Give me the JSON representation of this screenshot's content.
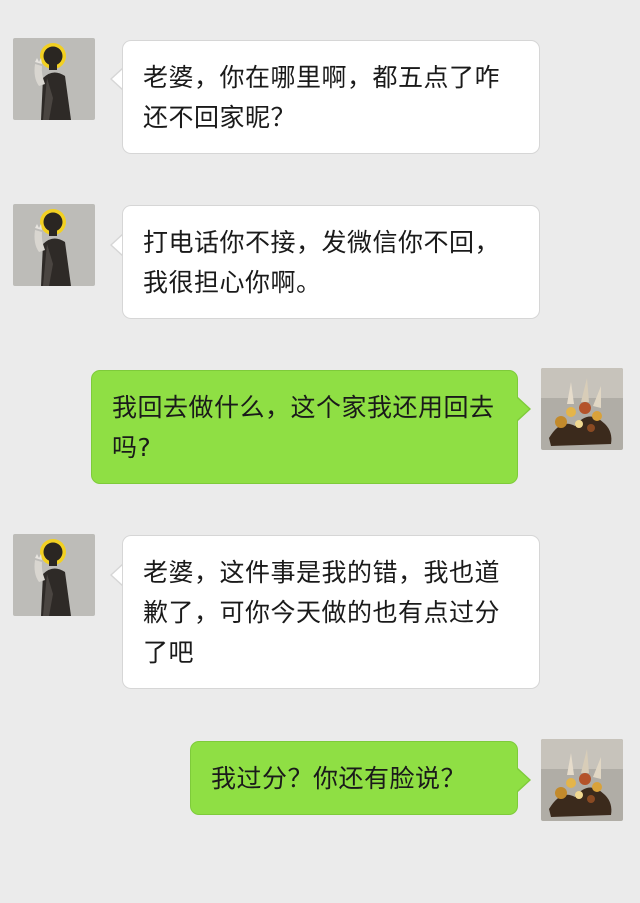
{
  "messages": [
    {
      "sender": "contact",
      "avatar_icon": "jesus-figure-avatar",
      "text": "老婆，你在哪里啊，都五点了咋还不回家昵？"
    },
    {
      "sender": "contact",
      "avatar_icon": "jesus-figure-avatar",
      "text": "打电话你不接，发微信你不回，我很担心你啊。"
    },
    {
      "sender": "self",
      "avatar_icon": "flower-basket-avatar",
      "text": "我回去做什么，这个家我还用回去吗?"
    },
    {
      "sender": "contact",
      "avatar_icon": "jesus-figure-avatar",
      "text": "老婆，这件事是我的错，我也道歉了，可你今天做的也有点过分了吧"
    },
    {
      "sender": "self",
      "avatar_icon": "flower-basket-avatar",
      "text": "我过分？你还有脸说？"
    }
  ],
  "colors": {
    "background": "#ebebeb",
    "incoming_bubble": "#ffffff",
    "outgoing_bubble": "#8fdf44"
  }
}
